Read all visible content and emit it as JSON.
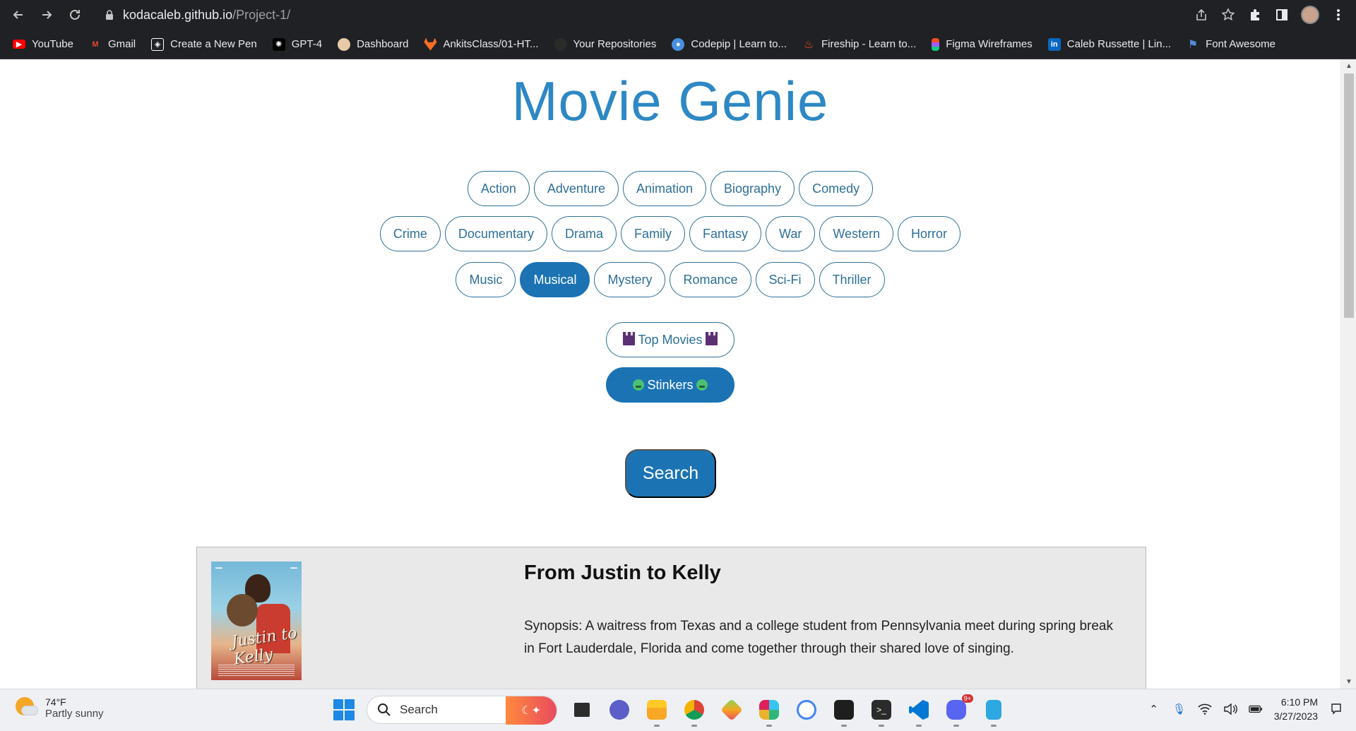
{
  "browser": {
    "url_host": "kodacaleb.github.io",
    "url_path": "/Project-1/",
    "bookmarks": [
      {
        "label": "YouTube",
        "icon": "youtube-icon",
        "color": "#ff0000"
      },
      {
        "label": "Gmail",
        "icon": "gmail-icon",
        "color": "#ea4335"
      },
      {
        "label": "Create a New Pen",
        "icon": "codepen-icon",
        "color": "#ffffff"
      },
      {
        "label": "GPT-4",
        "icon": "openai-icon",
        "color": "#ffffff"
      },
      {
        "label": "Dashboard",
        "icon": "dashboard-icon",
        "color": "#e8c9a8"
      },
      {
        "label": "AnkitsClass/01-HT...",
        "icon": "gitlab-icon",
        "color": "#fc6d26"
      },
      {
        "label": "Your Repositories",
        "icon": "github-icon",
        "color": "#2b2b2b"
      },
      {
        "label": "Codepip | Learn to...",
        "icon": "codepip-icon",
        "color": "#4a90e2"
      },
      {
        "label": "Fireship - Learn to...",
        "icon": "fireship-icon",
        "color": "#f4511e"
      },
      {
        "label": "Figma Wireframes",
        "icon": "figma-icon",
        "color": "#a259ff"
      },
      {
        "label": "Caleb Russette | Lin...",
        "icon": "linkedin-icon",
        "color": "#0a66c2"
      },
      {
        "label": "Font Awesome",
        "icon": "font-awesome-icon",
        "color": "#538dd7"
      }
    ]
  },
  "page": {
    "title": "Movie Genie",
    "genres_row1": [
      "Action",
      "Adventure",
      "Animation",
      "Biography",
      "Comedy"
    ],
    "genres_row2": [
      "Crime",
      "Documentary",
      "Drama",
      "Family",
      "Fantasy",
      "War",
      "Western",
      "Horror"
    ],
    "genres_row3": [
      "Music",
      "Musical",
      "Mystery",
      "Romance",
      "Sci-Fi",
      "Thriller"
    ],
    "selected_genre": "Musical",
    "top_movies_label": "Top Movies",
    "stinkers_label": "Stinkers",
    "search_label": "Search",
    "movie": {
      "title": "From Justin to Kelly",
      "synopsis": "Synopsis: A waitress from Texas and a college student from Pennsylvania meet during spring break in Fort Lauderdale, Florida and come together through their shared love of singing.",
      "poster_title": "Justin to Kelly"
    },
    "accent_color": "#1b73b4",
    "title_color": "#2d88c4"
  },
  "taskbar": {
    "weather_temp": "74°F",
    "weather_desc": "Partly sunny",
    "search_label": "Search",
    "time": "6:10 PM",
    "date": "3/27/2023",
    "notification_badge": "9+"
  }
}
